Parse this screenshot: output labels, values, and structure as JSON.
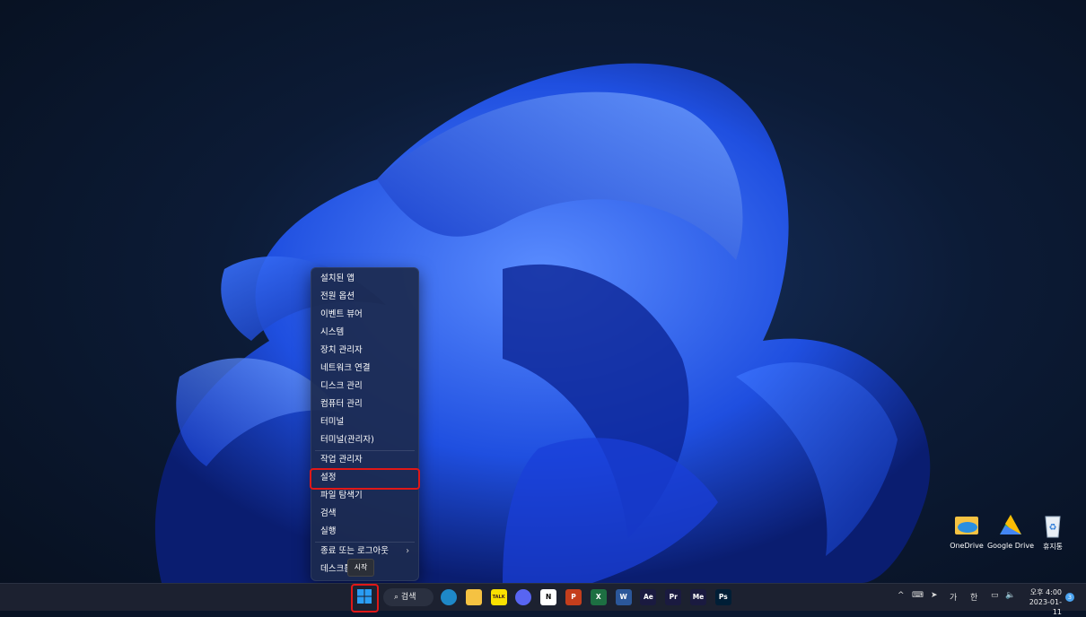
{
  "context_menu": {
    "items": [
      {
        "label": "설치된 앱"
      },
      {
        "label": "전원 옵션"
      },
      {
        "label": "이벤트 뷰어"
      },
      {
        "label": "시스템"
      },
      {
        "label": "장치 관리자"
      },
      {
        "label": "네트워크 연결"
      },
      {
        "label": "디스크 관리"
      },
      {
        "label": "컴퓨터 관리"
      },
      {
        "label": "터미널"
      },
      {
        "label": "터미널(관리자)"
      },
      {
        "label": "작업 관리자"
      },
      {
        "label": "설정"
      },
      {
        "label": "파일 탐색기"
      },
      {
        "label": "검색"
      },
      {
        "label": "실행"
      },
      {
        "label": "종료 또는 로그아웃"
      },
      {
        "label": "데스크톱"
      }
    ],
    "submenu_arrow": "›",
    "highlighted_item": "설정"
  },
  "tooltip": "시작",
  "desktop_icons": [
    {
      "label": "OneDrive",
      "icon": "onedrive-icon"
    },
    {
      "label": "Google Drive",
      "icon": "google-drive-icon"
    },
    {
      "label": "휴지통",
      "icon": "recycle-bin-icon"
    }
  ],
  "taskbar": {
    "search_label": "검색",
    "apps": [
      {
        "name": "edge-icon",
        "text": "",
        "color": "#1e88c8"
      },
      {
        "name": "file-explorer-icon",
        "text": "",
        "color": "#f5c242"
      },
      {
        "name": "kakaotalk-icon",
        "text": "TALK",
        "color": "#f9e000"
      },
      {
        "name": "discord-icon",
        "text": "",
        "color": "#5865f2"
      },
      {
        "name": "notion-icon",
        "text": "N",
        "color": "#ffffff"
      },
      {
        "name": "powerpoint-icon",
        "text": "P",
        "color": "#c43e1c"
      },
      {
        "name": "excel-icon",
        "text": "X",
        "color": "#1d6f42"
      },
      {
        "name": "word-icon",
        "text": "W",
        "color": "#2b579a"
      },
      {
        "name": "after-effects-icon",
        "text": "Ae",
        "color": "#1a1a40"
      },
      {
        "name": "premiere-icon",
        "text": "Pr",
        "color": "#1a1a40"
      },
      {
        "name": "media-encoder-icon",
        "text": "Me",
        "color": "#1a1a40"
      },
      {
        "name": "photoshop-icon",
        "text": "Ps",
        "color": "#001e36"
      }
    ],
    "tray": {
      "chevron": "^",
      "ime_1": "가",
      "ime_2": "한",
      "time": "오후 4:00",
      "date": "2023-01-11",
      "notification_count": "3"
    }
  },
  "colors": {
    "highlight": "#e01818",
    "accent": "#0078d4"
  }
}
